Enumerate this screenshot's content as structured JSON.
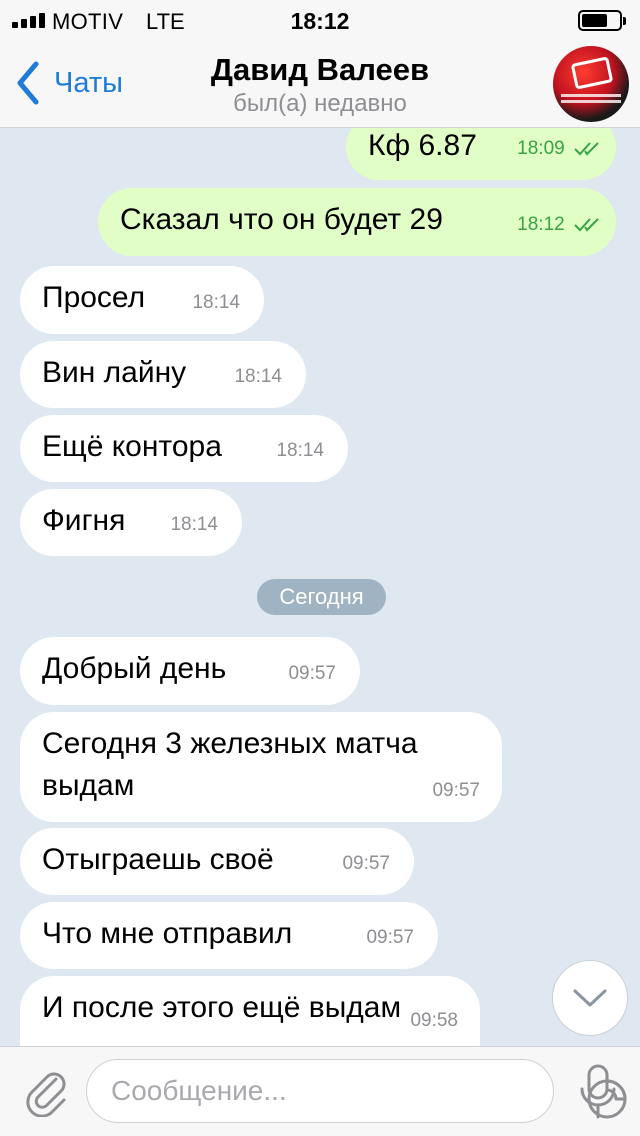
{
  "status_bar": {
    "carrier": "MOTIV",
    "network": "LTE",
    "time": "18:12"
  },
  "nav": {
    "back_label": "Чаты",
    "contact_name": "Давид Валеев",
    "contact_status": "был(а) недавно"
  },
  "messages": [
    {
      "direction": "out",
      "text": "Кф 6.87",
      "time": "18:09",
      "read": true
    },
    {
      "direction": "out",
      "text": "Сказал что он будет 29",
      "time": "18:12",
      "read": true
    },
    {
      "direction": "in",
      "text": "Просел",
      "time": "18:14"
    },
    {
      "direction": "in",
      "text": "Вин лайну",
      "time": "18:14"
    },
    {
      "direction": "in",
      "text": "Ещё контора",
      "time": "18:14"
    },
    {
      "direction": "in",
      "text": "Фигня",
      "time": "18:14"
    },
    {
      "direction": "in",
      "text": "Добрый день",
      "time": "09:57"
    },
    {
      "direction": "in",
      "text": "Сегодня 3 железных матча выдам",
      "time": "09:57"
    },
    {
      "direction": "in",
      "text": "Отыграешь своё",
      "time": "09:57"
    },
    {
      "direction": "in",
      "text": "Что мне отправил",
      "time": "09:57"
    },
    {
      "direction": "in",
      "text": "И после этого ещё выдам",
      "time": "09:58"
    }
  ],
  "date_separator": "Сегодня",
  "input": {
    "placeholder": "Сообщение..."
  },
  "colors": {
    "accent": "#1f7bd8",
    "outgoing_bubble": "#e1fec6",
    "incoming_bubble": "#ffffff",
    "chat_background": "#dfe8f1",
    "read_check": "#3aa246"
  },
  "icons": [
    "back-chevron-icon",
    "avatar",
    "double-check-icon",
    "chevron-down-icon",
    "paperclip-icon",
    "sticker-icon",
    "microphone-icon"
  ]
}
